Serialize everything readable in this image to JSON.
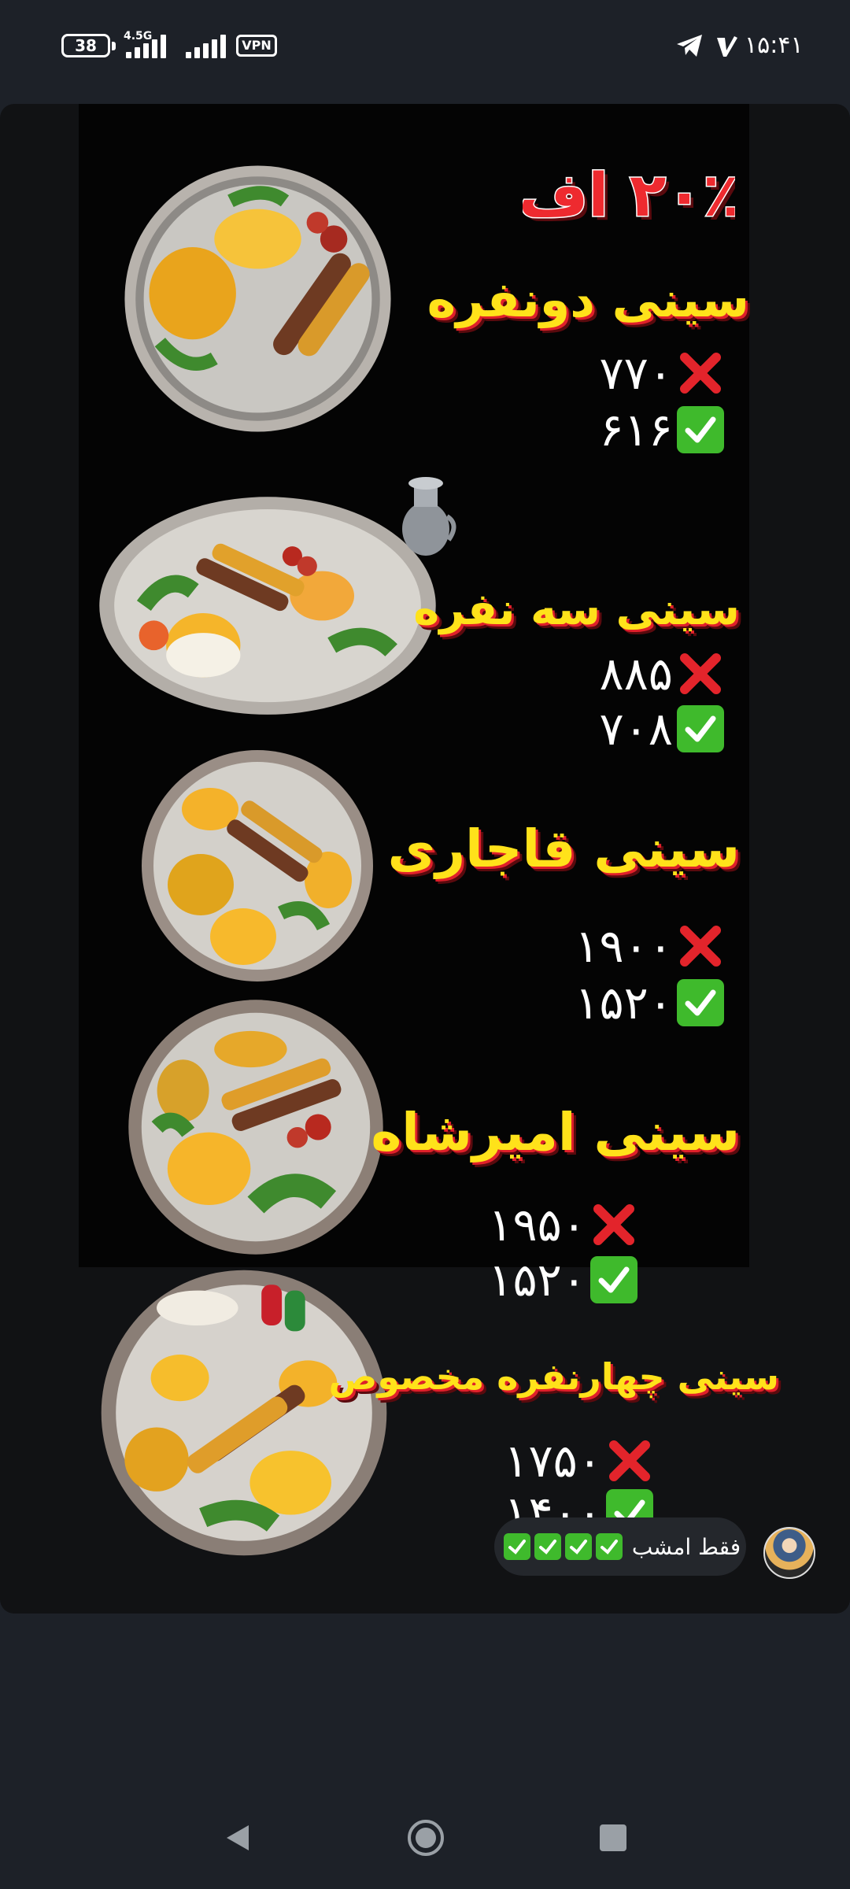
{
  "status_bar": {
    "battery": "38",
    "network_type": "4.5G",
    "vpn_label": "VPN",
    "time": "۱۵:۴۱"
  },
  "poster": {
    "discount": "۲۰٪ اف",
    "items": [
      {
        "title": "سینی دونفره",
        "old_price": "۷۷۰",
        "new_price": "۶۱۶"
      },
      {
        "title": "سینی سه نفره",
        "old_price": "۸۸۵",
        "new_price": "۷۰۸"
      },
      {
        "title": "سینی قاجاری",
        "old_price": "۱۹۰۰",
        "new_price": "۱۵۲۰"
      },
      {
        "title": "سینی امیرشاه",
        "old_price": "۱۹۵۰",
        "new_price": "۱۵۲۰"
      },
      {
        "title": "سینی چهارنفره مخصوص",
        "old_price": "۱۷۵۰",
        "new_price": "۱۴۰۰"
      }
    ]
  },
  "caption": {
    "text": "فقط امشب",
    "check_count": 4
  },
  "colors": {
    "title_yellow": "#ffe21a",
    "title_shadow_red": "#e0202a",
    "check_green": "#3fba2c",
    "cross_red": "#e3242b"
  }
}
